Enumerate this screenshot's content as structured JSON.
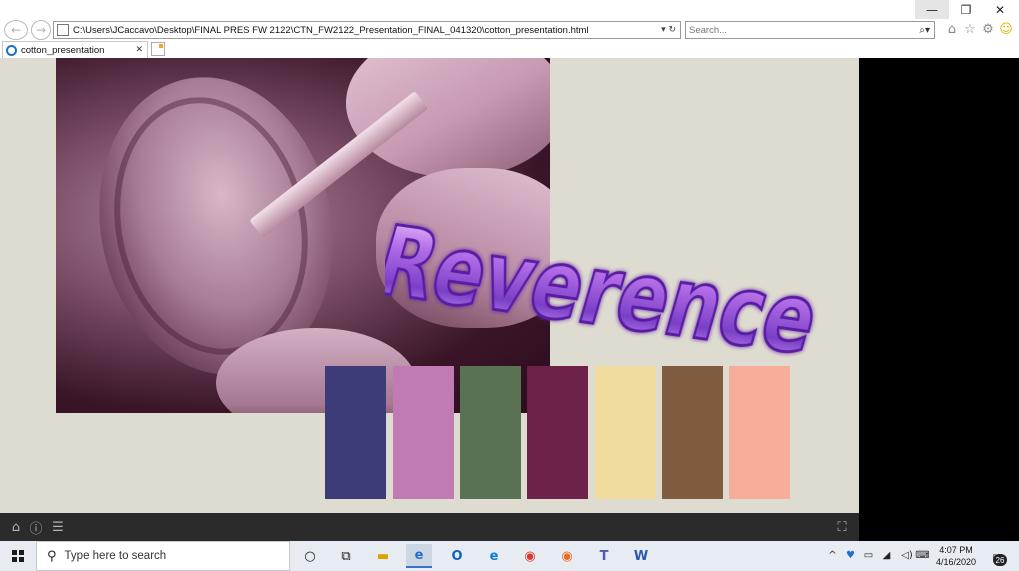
{
  "window": {
    "minimize_glyph": "—",
    "restore_glyph": "❐",
    "close_glyph": "✕"
  },
  "browser": {
    "back_icon": "arrow-left-icon",
    "forward_icon": "arrow-right-icon",
    "address": "C:\\Users\\JCaccavo\\Desktop\\FINAL PRES FW 2122\\CTN_FW2122_Presentation_FINAL_041320\\cotton_presentation.html",
    "address_tools": "▾ ↻",
    "search_placeholder": "Search...",
    "search_icon_glyph": "⌕▾",
    "toolbar_icons": [
      "home-icon",
      "favorites-star-icon",
      "settings-gear-icon",
      "smiley-feedback-icon"
    ],
    "tab_label": "cotton_presentation",
    "tab_close": "✕"
  },
  "slide": {
    "title_word": "Reverence",
    "background": "#dedbd0",
    "palette": [
      "#3d3b78",
      "#c07ab4",
      "#587253",
      "#6e2249",
      "#efdc9e",
      "#7f5b40",
      "#f6ae9a"
    ]
  },
  "viewer": {
    "home_glyph": "⌂",
    "info_glyph": "ⓘ",
    "menu_glyph": "☰",
    "fullscreen_glyph": "⛶"
  },
  "taskbar": {
    "search_placeholder": "Type here to search",
    "search_glyph": "⚲",
    "time": "4:07 PM",
    "date": "4/16/2020",
    "notification_count": "26",
    "tray_glyphs": [
      "^",
      "♥",
      "▭",
      "◢",
      "◁)",
      "⌨"
    ]
  }
}
